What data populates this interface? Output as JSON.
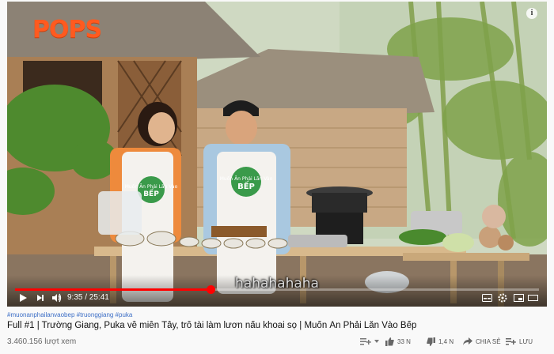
{
  "player": {
    "logo": "POPS",
    "info_icon": "i",
    "caption": "hahahahaha",
    "current_time": "9:35",
    "duration": "25:41",
    "time_display": "9:35 / 25:41",
    "progress": 0.373,
    "colors": {
      "progress": "#ff0000",
      "logo": "#ff5a1f"
    },
    "apron_text_1": "Muốn Ăn Phải Lăn Vào",
    "apron_text_2": "BẾP",
    "icons": [
      "play-icon",
      "next-icon",
      "volume-icon",
      "subtitles-icon",
      "settings-icon",
      "miniplayer-icon",
      "theater-icon",
      "fullscreen-icon"
    ]
  },
  "video": {
    "hashtags": "#muonanphailanvaobep #truonggiang #puka",
    "title": "Full #1 | Trường Giang, Puka về miền Tây, trổ tài làm lươn nấu khoai sọ | Muốn Ăn Phải Lăn Vào Bếp",
    "views": "3.460.156 lượt xem",
    "likes": "33 N",
    "dislikes": "1,4 N",
    "share_label": "CHIA SẺ",
    "save_label": "LƯU"
  }
}
